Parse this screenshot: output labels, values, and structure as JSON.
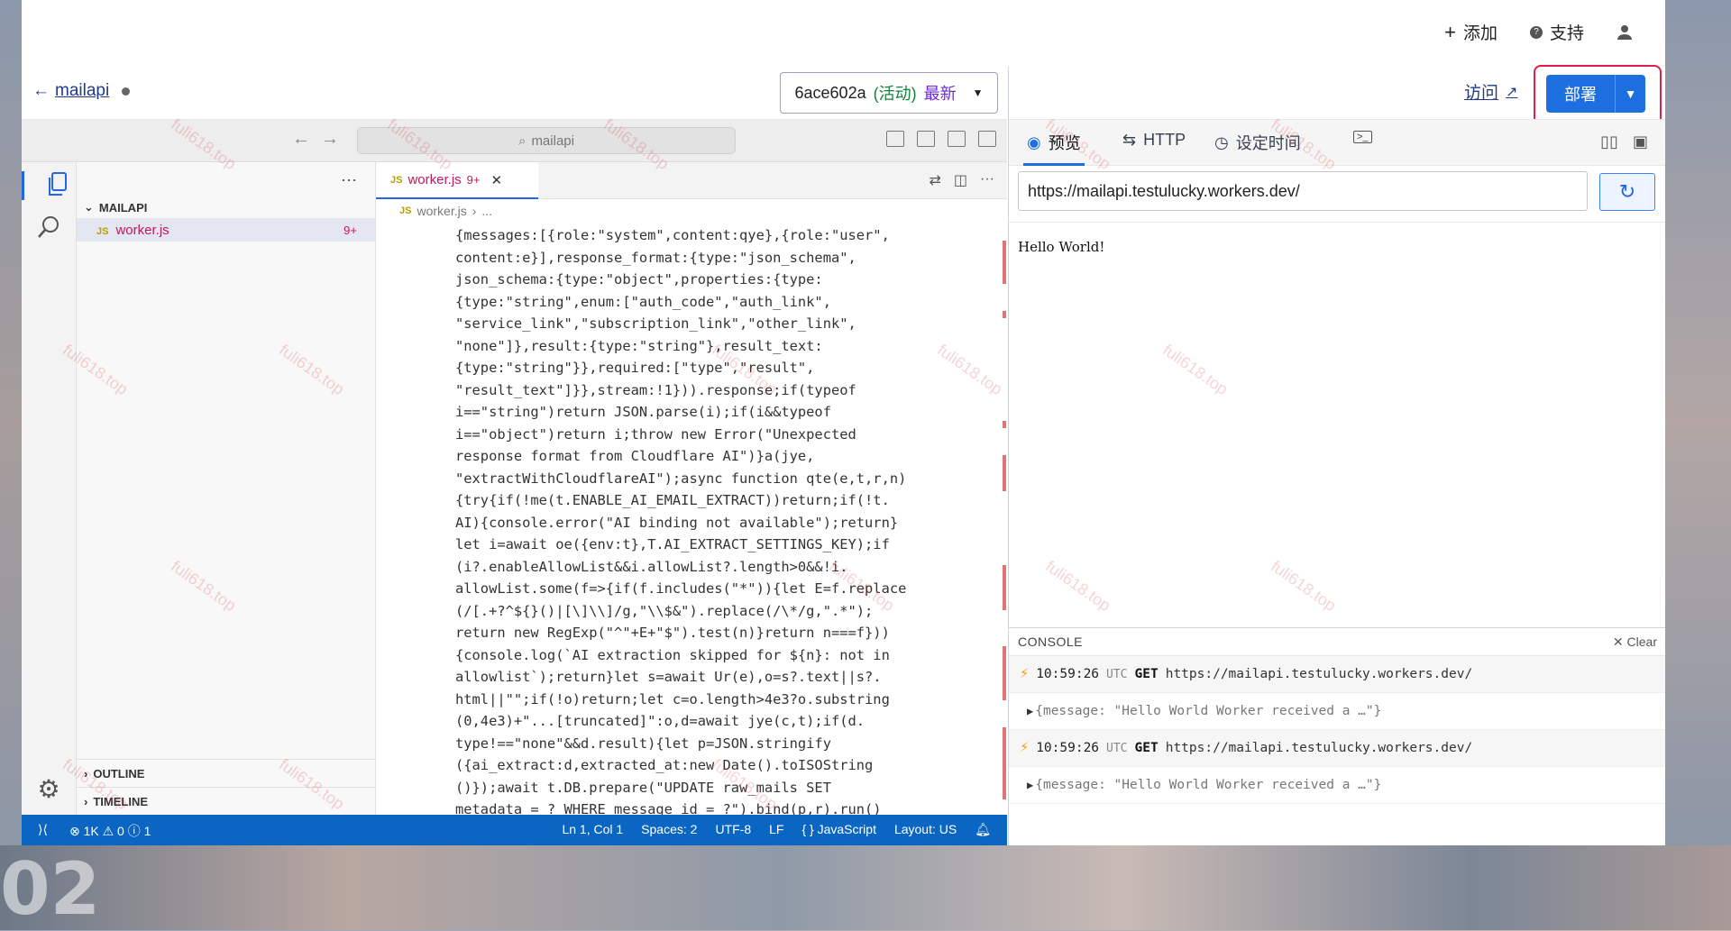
{
  "topnav": {
    "add": "添加",
    "support": "支持"
  },
  "worker": {
    "back_name": "mailapi",
    "version_id": "6ace602a",
    "version_active": "(活动)",
    "version_latest": "最新"
  },
  "editor": {
    "search_placeholder": "mailapi",
    "explorer_title": "MAILAPI",
    "file_name": "worker.js",
    "file_problems": "9+",
    "tab_label": "worker.js",
    "tab_problems": "9+",
    "breadcrumb_file": "worker.js",
    "breadcrumb_more": "...",
    "outline": "OUTLINE",
    "timeline": "TIMELINE",
    "code_lines": [
      "{messages:[{role:\"system\",content:qye},{role:\"user\",",
      "content:e}],response_format:{type:\"json_schema\",",
      "json_schema:{type:\"object\",properties:{type:",
      "{type:\"string\",enum:[\"auth_code\",\"auth_link\",",
      "\"service_link\",\"subscription_link\",\"other_link\",",
      "\"none\"]},result:{type:\"string\"},result_text:",
      "{type:\"string\"}},required:[\"type\",\"result\",",
      "\"result_text\"]}},stream:!1})).response;if(typeof",
      "i==\"string\")return JSON.parse(i);if(i&&typeof",
      "i==\"object\")return i;throw new Error(\"Unexpected",
      "response format from Cloudflare AI\")}a(jye,",
      "\"extractWithCloudflareAI\");async function qte(e,t,r,n)",
      "{try{if(!me(t.ENABLE_AI_EMAIL_EXTRACT))return;if(!t.",
      "AI){console.error(\"AI binding not available\");return}",
      "let i=await oe({env:t},T.AI_EXTRACT_SETTINGS_KEY);if",
      "(i?.enableAllowList&&i.allowList?.length>0&&!i.",
      "allowList.some(f=>{if(f.includes(\"*\")){let E=f.replace",
      "(/[.+?^${}()|[\\]\\\\]/g,\"\\\\$&\").replace(/\\*/g,\".*\");",
      "return new RegExp(\"^\"+E+\"$\").test(n)}return n===f}))",
      "{console.log(`AI extraction skipped for ${n}: not in",
      "allowlist`);return}let s=await Ur(e),o=s?.text||s?.",
      "html||\"\";if(!o)return;let c=o.length>4e3?o.substring",
      "(0,4e3)+\"...[truncated]\":o,d=await jye(c,t);if(d.",
      "type!==\"none\"&&d.result){let p=JSON.stringify",
      "({ai_extract:d,extracted_at:new Date().toISOString",
      "()});await t.DB.prepare(\"UPDATE raw_mails SET",
      "metadata = ? WHERE message_id = ?\").bind(p,r).run()"
    ]
  },
  "status": {
    "errors": "1K",
    "warnings": "0",
    "info": "1",
    "position": "Ln 1, Col 1",
    "spaces": "Spaces: 2",
    "encoding": "UTF-8",
    "eol": "LF",
    "language": "JavaScript",
    "layout": "Layout: US"
  },
  "right": {
    "visit": "访问",
    "deploy": "部署",
    "tabs": {
      "preview": "预览",
      "http": "HTTP",
      "schedule": "设定时间"
    },
    "url": "https://mailapi.testulucky.workers.dev/",
    "response_text": "Hello World!",
    "console_title": "CONSOLE",
    "console_clear": "Clear",
    "logs": [
      {
        "time": "10:59:26",
        "tz": "UTC",
        "method": "GET",
        "url": "https://mailapi.testulucky.workers.dev/",
        "message": "{message: \"Hello World Worker received a …\"}"
      },
      {
        "time": "10:59:26",
        "tz": "UTC",
        "method": "GET",
        "url": "https://mailapi.testulucky.workers.dev/",
        "message": "{message: \"Hello World Worker received a …\"}"
      }
    ]
  },
  "watermark": "fuli618.top",
  "colors": {
    "accent": "#1d6fe0",
    "statusbar": "#0a66c2",
    "highlight_border": "#e11d48",
    "error_text": "#c2185b"
  }
}
